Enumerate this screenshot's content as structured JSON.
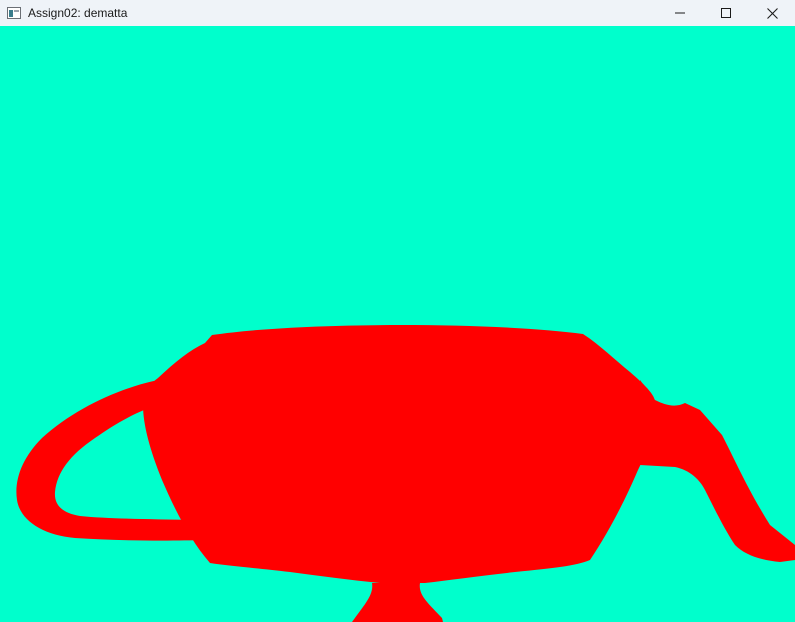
{
  "window": {
    "title": "Assign02: dematta",
    "controls": {
      "minimize_icon": "minimize-icon",
      "maximize_icon": "maximize-icon",
      "close_icon": "close-icon"
    }
  },
  "render": {
    "background_color": "#00ffcc",
    "object_color": "#ff0000",
    "object": "teapot"
  }
}
